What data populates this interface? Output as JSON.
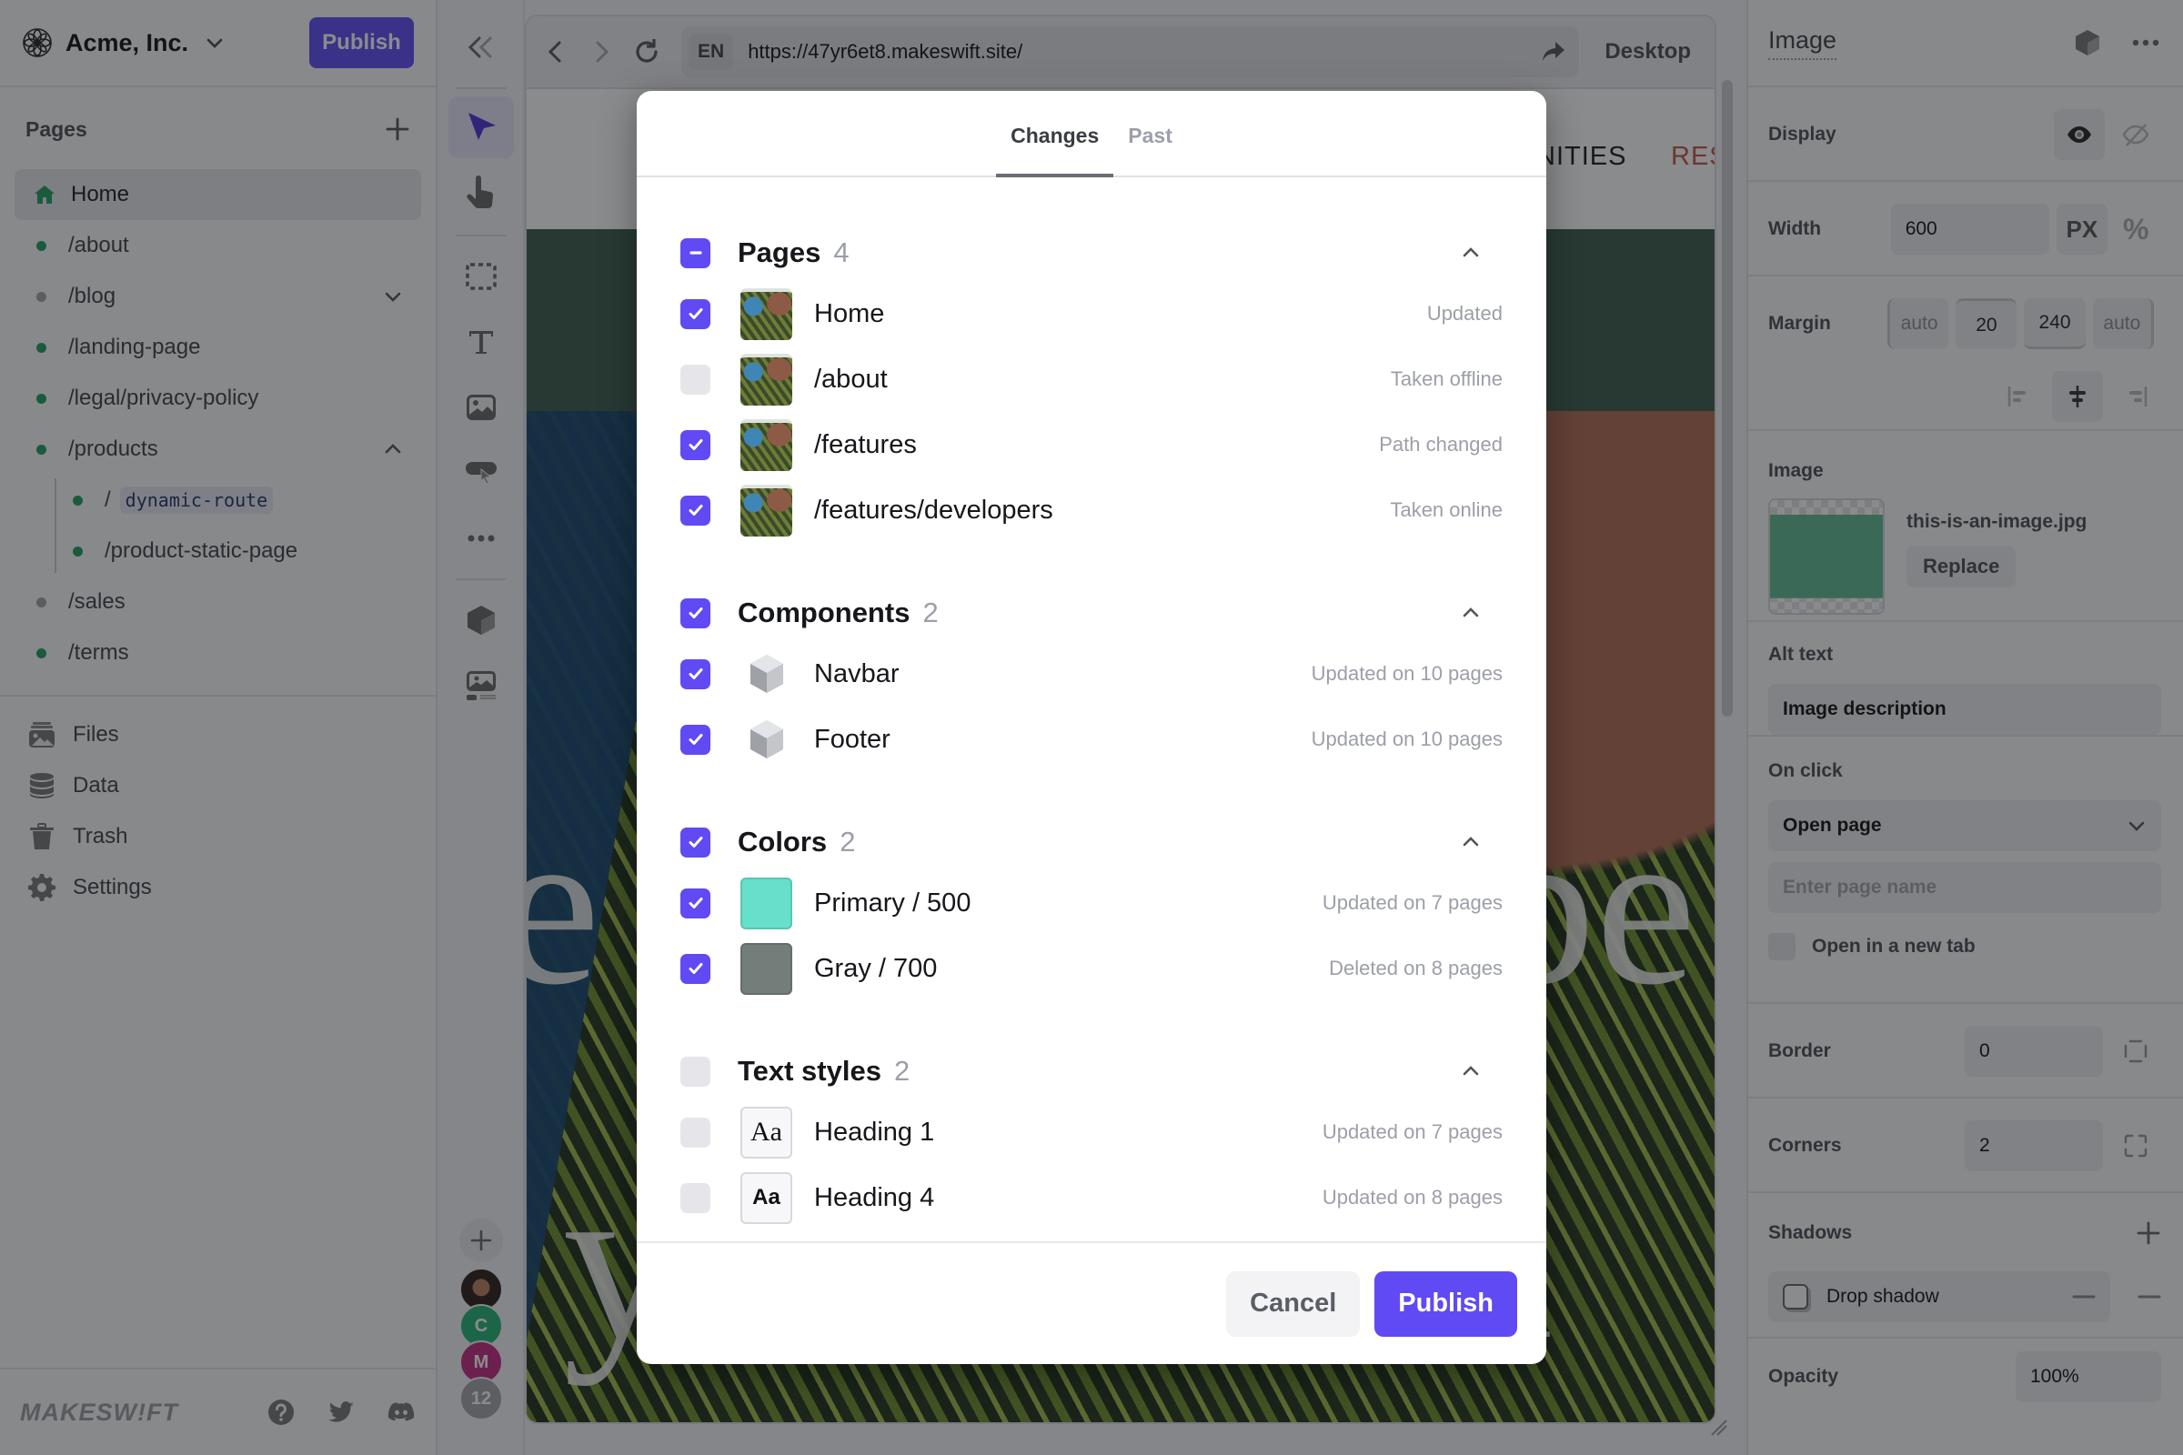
{
  "app": {
    "org_name": "Acme, Inc.",
    "publish_label": "Publish",
    "brand": "MAKESW!FT",
    "colors": {
      "accent": "#5f4af4",
      "live": "#1f9d5f",
      "draft": "#a1a3aa"
    }
  },
  "sidebar": {
    "pages_title": "Pages",
    "pages": [
      {
        "label": "Home",
        "icon": "home-icon",
        "status": "live",
        "active": true
      },
      {
        "label": "/about",
        "status": "live"
      },
      {
        "label": "/blog",
        "status": "draft",
        "expand": "collapsed"
      },
      {
        "label": "/landing-page",
        "status": "live"
      },
      {
        "label": "/legal/privacy-policy",
        "status": "live"
      },
      {
        "label": "/products",
        "status": "live",
        "expand": "expanded",
        "children": [
          {
            "prefix": "/",
            "label": "dynamic-route",
            "status": "live"
          },
          {
            "label": "/product-static-page",
            "status": "live"
          }
        ]
      },
      {
        "label": "/sales",
        "status": "draft"
      },
      {
        "label": "/terms",
        "status": "live"
      }
    ],
    "utilities": [
      {
        "label": "Files",
        "icon": "files-icon"
      },
      {
        "label": "Data",
        "icon": "database-icon"
      },
      {
        "label": "Trash",
        "icon": "trash-icon"
      },
      {
        "label": "Settings",
        "icon": "gear-icon"
      }
    ],
    "footer_icons": [
      "help-icon",
      "twitter-icon",
      "discord-icon"
    ]
  },
  "toolbar": {
    "tools": [
      "select-tool",
      "hand-tool",
      "box-tool",
      "text-tool",
      "image-tool",
      "button-tool",
      "more-tool",
      "component-tool",
      "media-tool"
    ],
    "avatars": [
      {
        "type": "photo"
      },
      {
        "type": "initial",
        "label": "C",
        "color": "#22b573"
      },
      {
        "type": "initial",
        "label": "M",
        "color": "#c2287f"
      },
      {
        "type": "count",
        "label": "12"
      }
    ]
  },
  "browser": {
    "lang": "EN",
    "url": "https://47yr6et8.makeswift.site/",
    "device": "Desktop"
  },
  "site": {
    "nav_links": [
      {
        "label": "NITIES",
        "color": "#1a1a1a"
      },
      {
        "label": "RES",
        "color": "#c4553f"
      }
    ],
    "hero_line1_left": "e",
    "hero_line1_right": "be",
    "hero_line2": "your travel"
  },
  "modal": {
    "tabs": [
      {
        "label": "Changes",
        "active": true
      },
      {
        "label": "Past",
        "active": false
      }
    ],
    "sections": [
      {
        "title": "Pages",
        "count": "4",
        "checked": "indeterminate",
        "rows": [
          {
            "name": "Home",
            "status": "Updated",
            "checked": true,
            "thumb": "page"
          },
          {
            "name": "/about",
            "status": "Taken offline",
            "checked": false,
            "thumb": "page"
          },
          {
            "name": "/features",
            "status": "Path changed",
            "checked": true,
            "thumb": "page"
          },
          {
            "name": "/features/developers",
            "status": "Taken online",
            "checked": true,
            "thumb": "page"
          }
        ]
      },
      {
        "title": "Components",
        "count": "2",
        "checked": "checked",
        "rows": [
          {
            "name": "Navbar",
            "status": "Updated on 10 pages",
            "checked": true,
            "thumb": "cube"
          },
          {
            "name": "Footer",
            "status": "Updated on 10 pages",
            "checked": true,
            "thumb": "cube"
          }
        ]
      },
      {
        "title": "Colors",
        "count": "2",
        "checked": "checked",
        "rows": [
          {
            "name": "Primary / 500",
            "status": "Updated on 7 pages",
            "checked": true,
            "thumb": "color",
            "swatch": "#67e0cb"
          },
          {
            "name": "Gray / 700",
            "status": "Deleted on 8 pages",
            "checked": true,
            "thumb": "color",
            "swatch": "#737d7a"
          }
        ]
      },
      {
        "title": "Text styles",
        "count": "2",
        "checked": "unchecked",
        "rows": [
          {
            "name": "Heading 1",
            "status": "Updated on 7 pages",
            "checked": false,
            "thumb": "typo",
            "sample": "Aa",
            "serif": true
          },
          {
            "name": "Heading 4",
            "status": "Updated on 8 pages",
            "checked": false,
            "thumb": "typo",
            "sample": "Aa",
            "serif": false
          }
        ]
      }
    ],
    "cancel_label": "Cancel",
    "publish_label": "Publish"
  },
  "inspector": {
    "title": "Image",
    "display_label": "Display",
    "width_label": "Width",
    "width_value": "600",
    "unit_px": "PX",
    "unit_pct": "%",
    "margin_label": "Margin",
    "margin": {
      "left": "auto",
      "top": "20",
      "bottom": "240",
      "right": "auto"
    },
    "image_label": "Image",
    "image_file": "this-is-an-image.jpg",
    "replace_label": "Replace",
    "alt_label": "Alt text",
    "alt_value": "Image description",
    "onclick_label": "On click",
    "onclick_value": "Open page",
    "page_placeholder": "Enter page name",
    "new_tab_label": "Open in a new tab",
    "border_label": "Border",
    "border_value": "0",
    "corners_label": "Corners",
    "corners_value": "2",
    "shadows_label": "Shadows",
    "shadow_item": "Drop shadow",
    "opacity_label": "Opacity",
    "opacity_value": "100%"
  }
}
